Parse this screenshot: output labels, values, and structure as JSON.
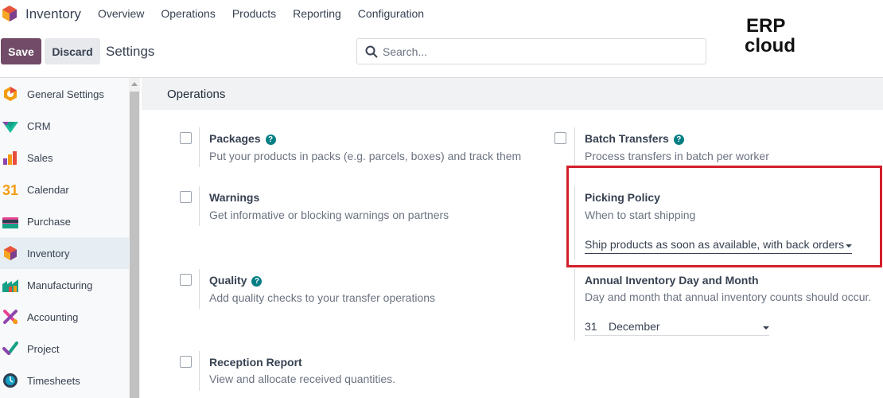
{
  "app": {
    "name": "Inventory"
  },
  "menu": [
    "Overview",
    "Operations",
    "Products",
    "Reporting",
    "Configuration"
  ],
  "controls": {
    "save": "Save",
    "discard": "Discard",
    "title": "Settings"
  },
  "search": {
    "placeholder": "Search..."
  },
  "brand": {
    "line1": "ERP",
    "line2": "cloud"
  },
  "sidebar": {
    "items": [
      {
        "label": "General Settings",
        "icon": "odoo-settings-icon"
      },
      {
        "label": "CRM",
        "icon": "crm-icon"
      },
      {
        "label": "Sales",
        "icon": "sales-icon"
      },
      {
        "label": "Calendar",
        "icon": "calendar-icon",
        "icon_text": "31"
      },
      {
        "label": "Purchase",
        "icon": "purchase-icon"
      },
      {
        "label": "Inventory",
        "icon": "inventory-icon"
      },
      {
        "label": "Manufacturing",
        "icon": "manufacturing-icon"
      },
      {
        "label": "Accounting",
        "icon": "accounting-icon"
      },
      {
        "label": "Project",
        "icon": "project-icon"
      },
      {
        "label": "Timesheets",
        "icon": "timesheets-icon"
      }
    ],
    "active": "Inventory"
  },
  "section": {
    "title": "Operations"
  },
  "options": {
    "packages": {
      "title": "Packages",
      "desc": "Put your products in packs (e.g. parcels, boxes) and track them",
      "help": "?"
    },
    "batch": {
      "title": "Batch Transfers",
      "desc": "Process transfers in batch per worker",
      "help": "?"
    },
    "warnings": {
      "title": "Warnings",
      "desc": "Get informative or blocking warnings on partners"
    },
    "picking": {
      "title": "Picking Policy",
      "desc": "When to start shipping",
      "value": "Ship products as soon as available, with back orders"
    },
    "quality": {
      "title": "Quality",
      "desc": "Add quality checks to your transfer operations",
      "help": "?"
    },
    "annual": {
      "title": "Annual Inventory Day and Month",
      "desc": "Day and month that annual inventory counts should occur.",
      "day": "31",
      "month": "December"
    },
    "reception": {
      "title": "Reception Report",
      "desc": "View and allocate received quantities."
    }
  },
  "colors": {
    "primary": "#714b67",
    "help": "#017e84",
    "highlight": "#d21f2b"
  }
}
